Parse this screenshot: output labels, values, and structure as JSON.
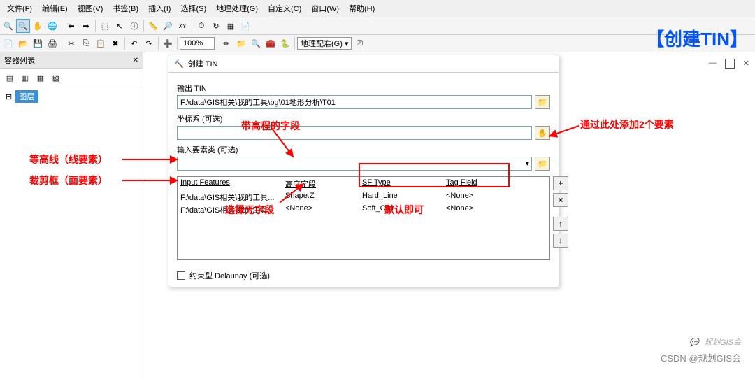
{
  "menu": {
    "file": "文件(F)",
    "edit": "编辑(E)",
    "view": "视图(V)",
    "bookmark": "书签(B)",
    "insert": "插入(I)",
    "select": "选择(S)",
    "geoprocess": "地理处理(G)",
    "custom": "自定义(C)",
    "window": "窗口(W)",
    "help": "帮助(H)"
  },
  "toolbar": {
    "zoom": "100%",
    "georef_label": "地理配准(G) ▾"
  },
  "toc": {
    "title": "容器列表",
    "layer": "图层"
  },
  "dialog": {
    "title": "创建 TIN",
    "out_label": "输出 TIN",
    "out_value": "F:\\data\\GIS相关\\我的工具\\bg\\01地形分析\\T01",
    "cs_label": "坐标系 (可选)",
    "in_label": "输入要素类 (可选)",
    "headers": {
      "c1": "Input Features",
      "c2": "高度字段",
      "c3": "SF Type",
      "c4": "Tag Field"
    },
    "rows": [
      {
        "c1": "F:\\data\\GIS相关\\我的工具...",
        "c2": "Shape.Z",
        "c3": "Hard_Line",
        "c4": "<None>"
      },
      {
        "c1": "F:\\data\\GIS相关\\我的工具...",
        "c2": "<None>",
        "c3": "Soft_Clip",
        "c4": "<None>"
      }
    ],
    "delaunay": "约束型 Delaunay (可选)"
  },
  "annotations": {
    "banner": "【创建TIN】",
    "elev_field": "带高程的字段",
    "contour": "等高线（线要素）",
    "clip": "裁剪框（面要素）",
    "no_field": "选择无字段",
    "default_ok": "默认即可",
    "add_feat": "通过此处添加2个要素"
  },
  "watermark": {
    "brand": "规划GIS会",
    "csdn": "CSDN @规划GIS会"
  },
  "icons": {
    "plus": "+",
    "times": "×",
    "up": "↑",
    "down": "↓",
    "hammer": "🔨",
    "pin": "⊕"
  }
}
